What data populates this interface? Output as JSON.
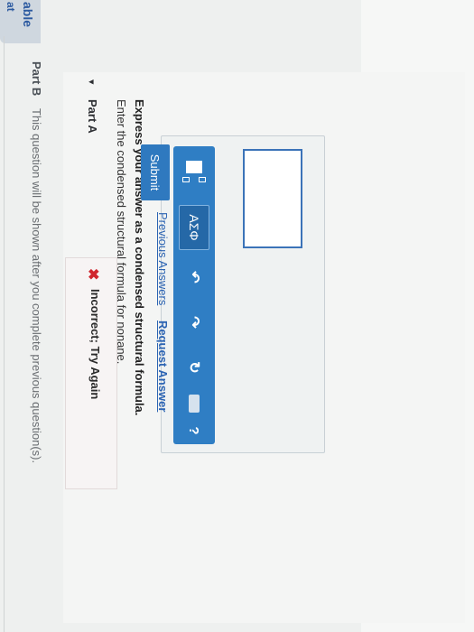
{
  "sidebar_tab": {
    "label_top": "able",
    "label_bottom": "at"
  },
  "part_a": {
    "caret": "▾",
    "title": "Part A",
    "instruction": "Enter the condensed structural formula for nonane.",
    "instruction_bold": "Express your answer as a condensed structural formula."
  },
  "toolbar": {
    "greek_label": "AΣΦ",
    "undo_icon": "↶",
    "redo_icon": "↷",
    "reset_icon": "↻",
    "help_label": "?"
  },
  "answer": {
    "value": ""
  },
  "actions": {
    "submit_label": "Submit",
    "previous_answers_label": "Previous Answers",
    "request_answer_label": "Request Answer"
  },
  "feedback": {
    "icon": "✖",
    "text": "Incorrect; Try Again"
  },
  "part_b": {
    "label": "Part B",
    "text": "This question will be shown after you complete previous question(s)."
  }
}
